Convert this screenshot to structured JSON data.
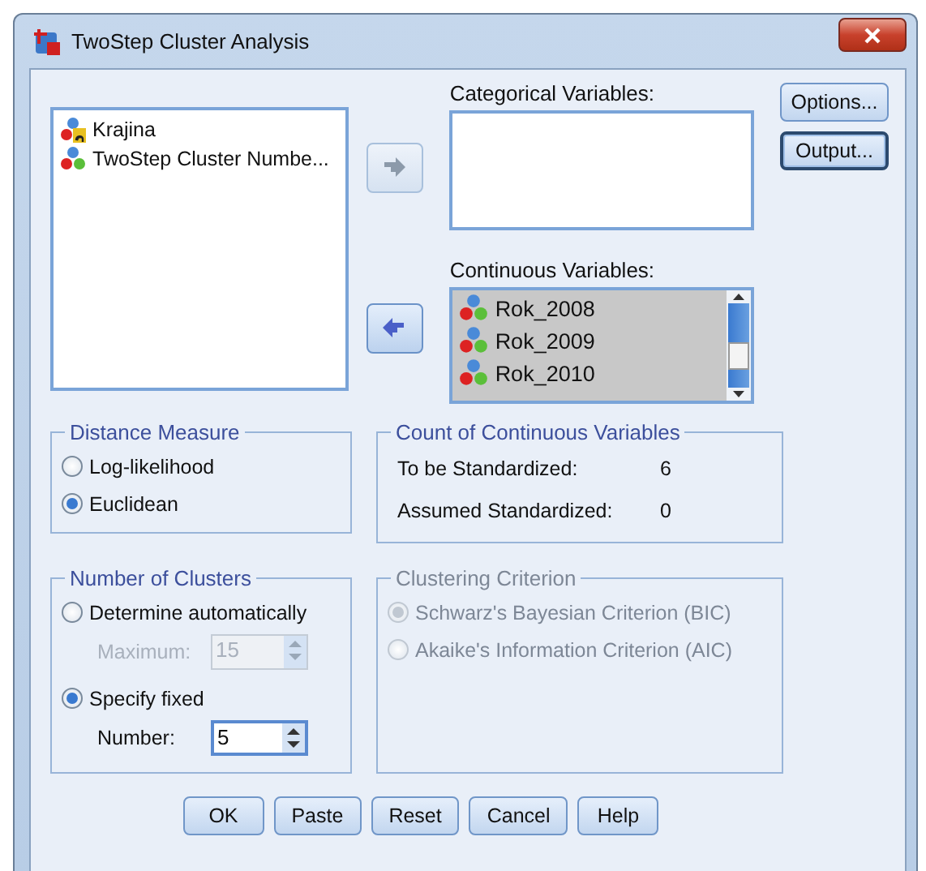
{
  "window": {
    "title": "TwoStep Cluster Analysis"
  },
  "source_list": {
    "items": [
      {
        "label": "Krajina",
        "kind": "nominal"
      },
      {
        "label": "TwoStep Cluster Numbe...",
        "kind": "scale"
      }
    ]
  },
  "move_buttons": [
    {
      "kind": "move_right",
      "disabled": true
    },
    {
      "kind": "move_left",
      "disabled": false
    }
  ],
  "categorical": {
    "label": "Categorical Variables:"
  },
  "continuous": {
    "label": "Continuous Variables:",
    "items": [
      {
        "label": "Rok_2008",
        "kind": "scale"
      },
      {
        "label": "Rok_2009",
        "kind": "scale"
      },
      {
        "label": "Rok_2010",
        "kind": "scale"
      }
    ]
  },
  "side_buttons": [
    {
      "label": "Options...",
      "focused": false
    },
    {
      "label": "Output...",
      "focused": true
    }
  ],
  "distance_measure": {
    "title": "Distance Measure",
    "options": [
      {
        "label": "Log-likelihood",
        "selected": false
      },
      {
        "label": "Euclidean",
        "selected": true
      }
    ]
  },
  "count": {
    "title": "Count of Continuous Variables",
    "rows": [
      {
        "label": "To be Standardized:",
        "value": "6"
      },
      {
        "label": "Assumed Standardized:",
        "value": "0"
      }
    ]
  },
  "number_of_clusters": {
    "title": "Number of Clusters",
    "options": [
      {
        "label": "Determine automatically",
        "selected": false,
        "field": {
          "label": "Maximum:",
          "value": "15",
          "disabled": true
        }
      },
      {
        "label": "Specify fixed",
        "selected": true,
        "field": {
          "label": "Number:",
          "value": "5",
          "disabled": false
        }
      }
    ]
  },
  "clustering_criterion": {
    "title": "Clustering Criterion",
    "disabled": true,
    "options": [
      {
        "label": "Schwarz's Bayesian Criterion (BIC)",
        "selected": true
      },
      {
        "label": "Akaike's Information Criterion (AIC)",
        "selected": false
      }
    ]
  },
  "buttons": [
    {
      "label": "OK"
    },
    {
      "label": "Paste"
    },
    {
      "label": "Reset"
    },
    {
      "label": "Cancel"
    },
    {
      "label": "Help"
    }
  ]
}
